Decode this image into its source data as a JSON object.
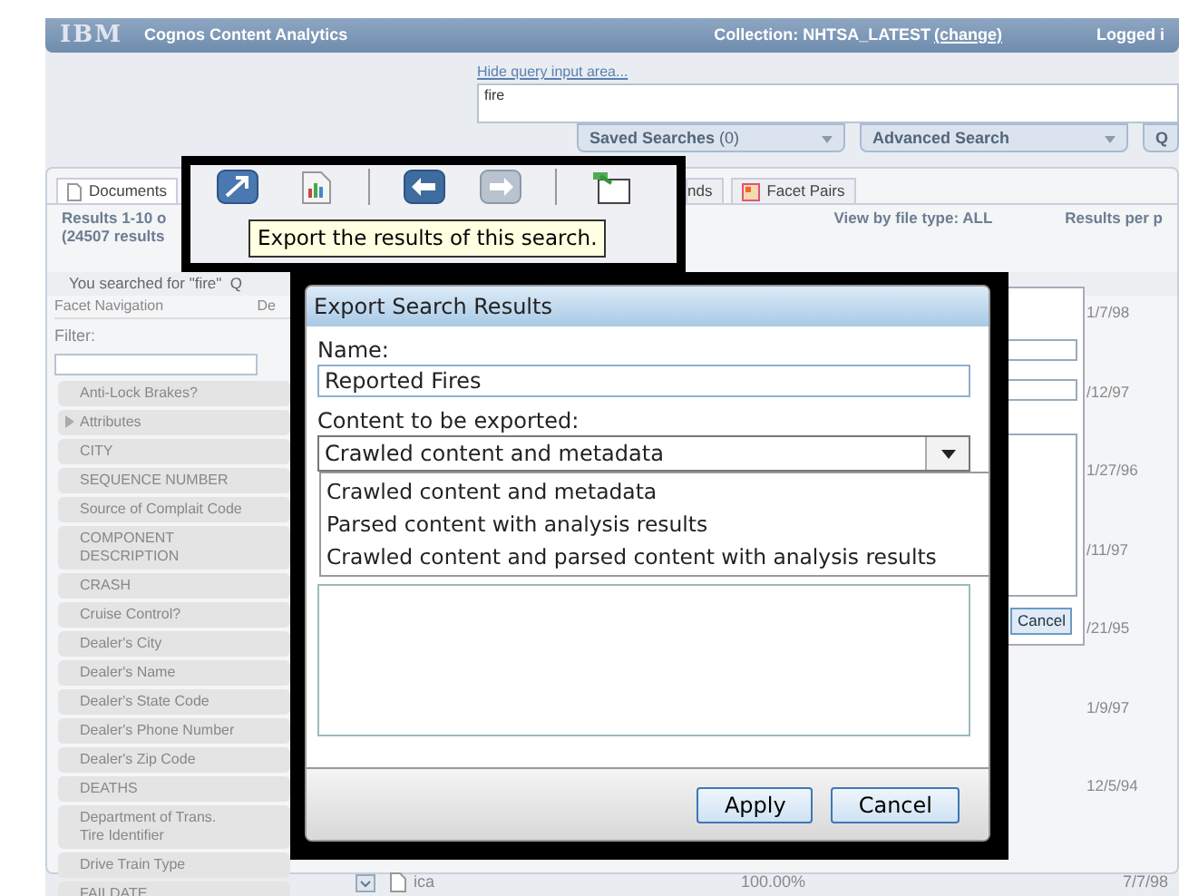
{
  "header": {
    "logo": "IBM",
    "product": "Cognos Content Analytics",
    "collection": "Collection: NHTSA_LATEST",
    "collection_link": "(change)",
    "user": "Logged i"
  },
  "query": {
    "hide_link": "Hide query input area...",
    "value": "fire",
    "dropdowns": [
      {
        "label": "Saved Searches",
        "count": "(0)"
      },
      {
        "label": "Advanced Search"
      },
      {
        "label": "Q"
      }
    ]
  },
  "tabs": [
    {
      "label": "Documents",
      "selected": true
    },
    {
      "label": "nds",
      "selected": false
    },
    {
      "label": "Facet Pairs",
      "selected": false
    }
  ],
  "results": {
    "summary": "Results 1-10 o\n(24507 results",
    "file_type_label": "View by file type:",
    "file_type": "ALL",
    "per_page": "Results per p",
    "searched_for": "You searched for \"fire\"  Q"
  },
  "facets": {
    "title": "Facet Navigation",
    "column_2": "De",
    "filter_label": "Filter:",
    "items": [
      {
        "label": "Anti-Lock Brakes?",
        "expandable": false
      },
      {
        "label": "Attributes",
        "expandable": true
      },
      {
        "label": "CITY",
        "expandable": false
      },
      {
        "label": "SEQUENCE NUMBER",
        "expandable": false
      },
      {
        "label": "Source of Complait Code",
        "expandable": false
      },
      {
        "label": "COMPONENT\nDESCRIPTION",
        "expandable": false
      },
      {
        "label": "CRASH",
        "expandable": false
      },
      {
        "label": "Cruise Control?",
        "expandable": false
      },
      {
        "label": "Dealer's City",
        "expandable": false
      },
      {
        "label": "Dealer's Name",
        "expandable": false
      },
      {
        "label": "Dealer's State Code",
        "expandable": false
      },
      {
        "label": "Dealer's Phone Number",
        "expandable": false
      },
      {
        "label": "Dealer's Zip Code",
        "expandable": false
      },
      {
        "label": "DEATHS",
        "expandable": false
      },
      {
        "label": "Department of Trans.\nTire Identifier",
        "expandable": false
      },
      {
        "label": "Drive Train Type",
        "expandable": false
      },
      {
        "label": "FAILDATE",
        "expandable": false
      }
    ]
  },
  "dates": [
    "1/7/98",
    "/12/97",
    "1/27/96",
    "/11/97",
    "/21/95",
    "1/9/97",
    "12/5/94"
  ],
  "last_row": {
    "name": "ica",
    "percent": "100.00%",
    "date": "7/7/98"
  },
  "behind_dialog": {
    "button": "Cancel"
  },
  "toolbar": {
    "buttons": [
      {
        "kind": "export"
      },
      {
        "kind": "report"
      },
      {
        "kind": "separator"
      },
      {
        "kind": "back"
      },
      {
        "kind": "forward"
      },
      {
        "kind": "separator"
      },
      {
        "kind": "new-window"
      }
    ],
    "tooltip": "Export the results of this search."
  },
  "dialog": {
    "title": "Export Search Results",
    "name_label": "Name:",
    "name_value": "Reported Fires",
    "content_label": "Content to be exported:",
    "content_value": "Crawled content and metadata",
    "options": [
      "Crawled content and metadata",
      "Parsed content with analysis results",
      "Crawled content and parsed content with analysis results"
    ],
    "buttons": [
      "Apply",
      "Cancel"
    ]
  }
}
